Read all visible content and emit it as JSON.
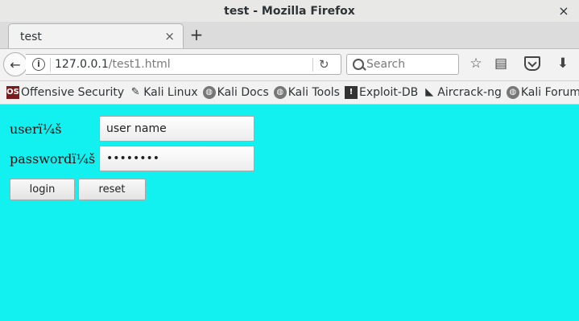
{
  "window": {
    "title": "test - Mozilla Firefox",
    "close_glyph": "×"
  },
  "tabs": [
    {
      "label": "test",
      "close_glyph": "×"
    }
  ],
  "new_tab_glyph": "+",
  "nav": {
    "back_icon": "arrow-left-icon",
    "back_glyph": "←",
    "info_glyph": "i",
    "url_host": "127.0.0.1",
    "url_path": "/test1.html",
    "reload_glyph": "↻",
    "search_placeholder": "Search",
    "star_glyph": "☆",
    "library_glyph": "▤",
    "download_glyph": "⬇"
  },
  "bookmarks": [
    {
      "label": "Offensive Security",
      "icon": "offsec-icon",
      "glyph": "OS"
    },
    {
      "label": "Kali Linux",
      "icon": "kali-dragon-icon",
      "glyph": "✎"
    },
    {
      "label": "Kali Docs",
      "icon": "globe-icon",
      "glyph": "◍"
    },
    {
      "label": "Kali Tools",
      "icon": "globe-icon",
      "glyph": "◍"
    },
    {
      "label": "Exploit-DB",
      "icon": "exploitdb-icon",
      "glyph": "!"
    },
    {
      "label": "Aircrack-ng",
      "icon": "aircrack-icon",
      "glyph": "◣"
    },
    {
      "label": "Kali Forums",
      "icon": "globe-icon",
      "glyph": "◍"
    }
  ],
  "form": {
    "user_label": "userï¼š",
    "user_value": "user name",
    "password_label": "passwordï¼š",
    "password_value": "********",
    "login_label": "login",
    "reset_label": "reset"
  },
  "colors": {
    "page_background": "#12f0f0",
    "chrome": "#f2f2f2"
  }
}
